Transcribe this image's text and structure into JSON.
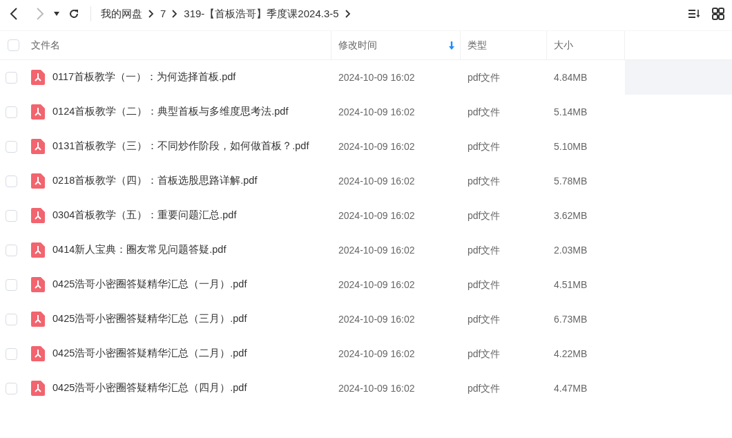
{
  "breadcrumb": [
    "我的网盘",
    "7",
    "319-【首板浩哥】季度课2024.3-5"
  ],
  "select_all_checked": false,
  "columns": [
    {
      "label": "文件名",
      "sorted": false
    },
    {
      "label": "修改时间",
      "sorted": true
    },
    {
      "label": "类型",
      "sorted": false
    },
    {
      "label": "大小",
      "sorted": false
    }
  ],
  "rows": [
    {
      "name": "0117首板教学（一）：为何选择首板.pdf",
      "modified": "2024-10-09 16:02",
      "type": "pdf文件",
      "size": "4.84MB",
      "checked": false,
      "hovered": true
    },
    {
      "name": "0124首板教学（二）：典型首板与多维度思考法.pdf",
      "modified": "2024-10-09 16:02",
      "type": "pdf文件",
      "size": "5.14MB",
      "checked": false,
      "hovered": false
    },
    {
      "name": "0131首板教学（三）：不同炒作阶段，如何做首板？.pdf",
      "modified": "2024-10-09 16:02",
      "type": "pdf文件",
      "size": "5.10MB",
      "checked": false,
      "hovered": false
    },
    {
      "name": "0218首板教学（四）：首板选股思路详解.pdf",
      "modified": "2024-10-09 16:02",
      "type": "pdf文件",
      "size": "5.78MB",
      "checked": false,
      "hovered": false
    },
    {
      "name": "0304首板教学（五）：重要问题汇总.pdf",
      "modified": "2024-10-09 16:02",
      "type": "pdf文件",
      "size": "3.62MB",
      "checked": false,
      "hovered": false
    },
    {
      "name": "0414新人宝典：圈友常见问题答疑.pdf",
      "modified": "2024-10-09 16:02",
      "type": "pdf文件",
      "size": "2.03MB",
      "checked": false,
      "hovered": false
    },
    {
      "name": "0425浩哥小密圈答疑精华汇总（一月）.pdf",
      "modified": "2024-10-09 16:02",
      "type": "pdf文件",
      "size": "4.51MB",
      "checked": false,
      "hovered": false
    },
    {
      "name": "0425浩哥小密圈答疑精华汇总（三月）.pdf",
      "modified": "2024-10-09 16:02",
      "type": "pdf文件",
      "size": "6.73MB",
      "checked": false,
      "hovered": false
    },
    {
      "name": "0425浩哥小密圈答疑精华汇总（二月）.pdf",
      "modified": "2024-10-09 16:02",
      "type": "pdf文件",
      "size": "4.22MB",
      "checked": false,
      "hovered": false
    },
    {
      "name": "0425浩哥小密圈答疑精华汇总（四月）.pdf",
      "modified": "2024-10-09 16:02",
      "type": "pdf文件",
      "size": "4.47MB",
      "checked": false,
      "hovered": false
    }
  ]
}
